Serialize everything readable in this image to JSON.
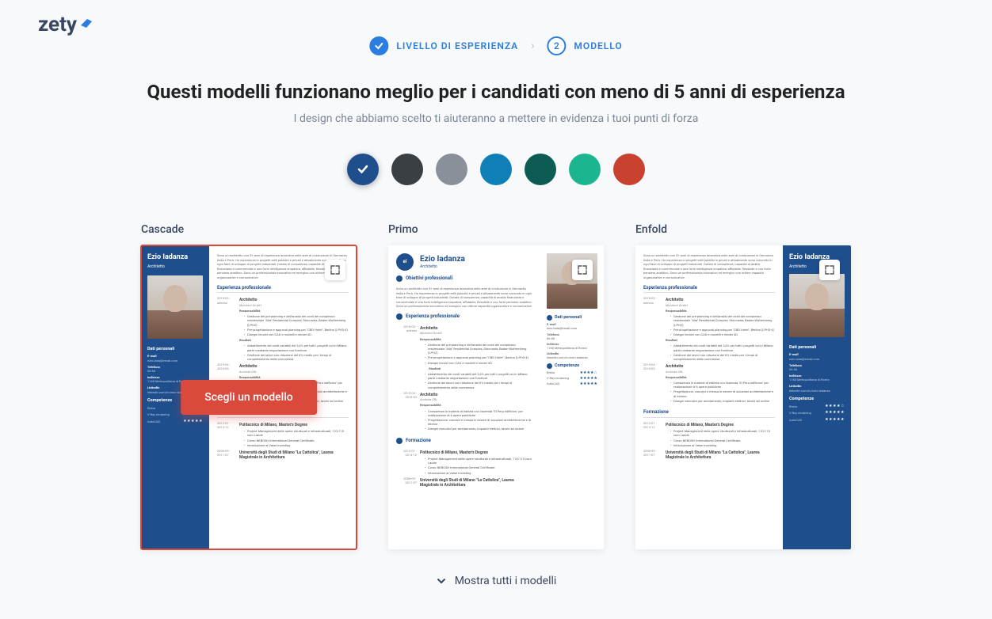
{
  "brand": "zety",
  "steps": {
    "step1_label": "LIVELLO DI ESPERIENZA",
    "step2_num": "2",
    "step2_label": "MODELLO"
  },
  "heading": "Questi modelli funzionano meglio per i candidati con meno di 5 anni di esperienza",
  "subtitle": "I design che abbiamo scelto ti aiuteranno a mettere in evidenza i tuoi punti di forza",
  "colors": [
    {
      "hex": "#1e4e8c",
      "selected": true
    },
    {
      "hex": "#3a3f44",
      "selected": false
    },
    {
      "hex": "#8a9099",
      "selected": false
    },
    {
      "hex": "#0f7fb8",
      "selected": false
    },
    {
      "hex": "#0d5c54",
      "selected": false
    },
    {
      "hex": "#1bb690",
      "selected": false
    },
    {
      "hex": "#c8422f",
      "selected": false
    }
  ],
  "choose_label": "Scegli un modello",
  "show_all_label": "Mostra tutti i modelli",
  "templates": [
    {
      "name": "Cascade",
      "selected": true,
      "variant": "cascade"
    },
    {
      "name": "Primo",
      "selected": false,
      "variant": "primo"
    },
    {
      "name": "Enfold",
      "selected": false,
      "variant": "enfold"
    }
  ],
  "resume": {
    "name": "Ezio Iadanza",
    "role": "Architetto",
    "initials": "ei",
    "summary": "Sono un architetto con 5+ anni di esperienza lavorativa nelle aree di costruzione in Germania, Italia e Perù. Ho esperienza in progetti edili pubblici e privati e attualmente sono coinvolto in ogni fase di sviluppo di progetti industriali. Dotato di consulenza, capacità di analisi finanziaria e commerciale e una forte intelligenza empatica, affidabile, flessibile e con forte pensiero analitico. Sono un professionista innovativo ed energico con ottime capacità organizzative e comunicative.",
    "sections": {
      "personal_title": "Dati personali",
      "email_label": "E-mail",
      "email": "ezio.iada@email.com",
      "phone_label": "Telefono",
      "phone": "06 68",
      "address_label": "Indirizzo",
      "address": "1160 Metropolitana di Roma",
      "linkedin_label": "LinkedIn",
      "linkedin": "linkedin.com/in/ezio-iadanza",
      "skills_title": "Competenze",
      "skills": [
        {
          "name": "Rhino",
          "stars": "★★★★☆"
        },
        {
          "name": "V-Ray rendering",
          "stars": "★★★★★"
        },
        {
          "name": "AutoCAD",
          "stars": "★★★★★"
        }
      ],
      "obj_title": "Obiettivi professionali",
      "exp_title": "Esperienza professionale",
      "exp": [
        {
          "dates": "2018-03 - adesso",
          "title": "Architetto",
          "company": "MyArtect GmbH",
          "resp_label": "Responsabilità",
          "resp": [
            "Gestione del pre-planning e dell'analisi dei costi del complesso residenziale \"Alia\" Residential Complex, Stoccarda, Baden-Wuttemberg (LPH2)",
            "Pre-progettazione e approval planning per \"CBD Hotel\", Berlino (LPH3-4)",
            "Disegni tecnici con CAD e modelli e render 3D"
          ],
          "res_label": "Risultati",
          "res": [
            "Abbattimento dei costi variabili del 3,4% per tutti i progetti cui in Milano parte mediante negoziazione con fornitore",
            "Gestione dei lavori con riduzione del 6% medio per i tempi di completamento della commessa"
          ]
        },
        {
          "dates": "2015-04 - 2018-03",
          "title": "Architetto",
          "company": "Archista SRL",
          "resp_label": "Responsabilità",
          "resp": [
            "Consulenza in materia di edilizia con l'azienda \"El Peru edificios\" per realizzazione di 6 opere pubbliche",
            "Progettazione, concept e messa in essere di soluzioni architettoniche e di interior",
            "Disegni esecutivi per arredamento, impianti elettrici, tavole ad ordine"
          ]
        }
      ],
      "edu_title": "Formazione",
      "edu": [
        {
          "dates": "2012-01 - 2014-12",
          "title": "Politecnico di Milano, Master's Degree",
          "lines": [
            "Project Management delle opere strutturali e infrastrutturali, 110/110 cum Laude",
            "Corso NEBOSH International General Certificate",
            "Introduzione al Value Investing"
          ]
        },
        {
          "dates": "2006-09 - 2011-07",
          "title": "Università degli Studi di Milano \"La Cattolica\", Laurea Magistrale in Architettura"
        }
      ]
    }
  }
}
